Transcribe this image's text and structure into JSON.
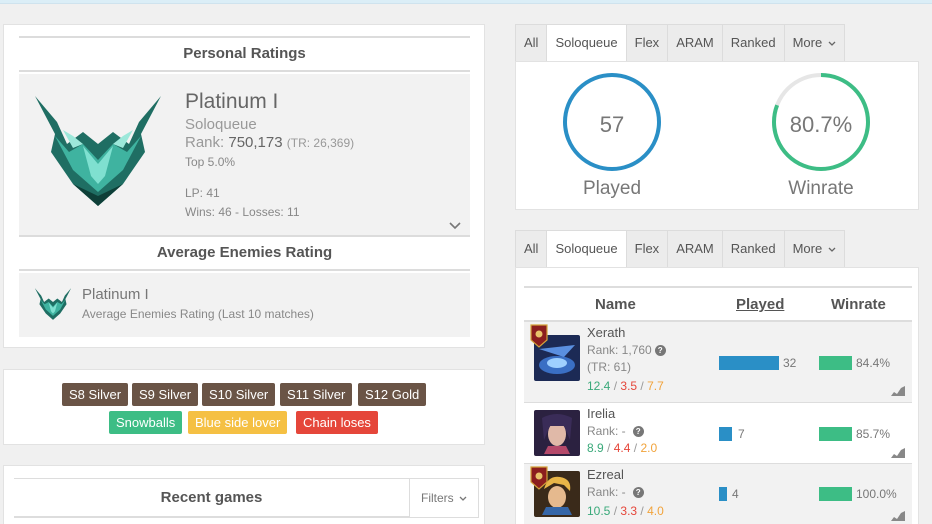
{
  "ratings": {
    "title": "Personal Ratings",
    "tier": "Platinum I",
    "queue": "Soloqueue",
    "rank_label": "Rank:",
    "rank_value": "750,173",
    "tr": "(TR: 26,369)",
    "top": "Top 5.0%",
    "lp": "LP: 41",
    "wins_losses": "Wins: 46 - Losses: 11"
  },
  "enemies": {
    "title": "Average Enemies Rating",
    "tier": "Platinum I",
    "desc": "Average Enemies Rating (Last 10 matches)"
  },
  "badges": {
    "seasons": [
      "S8 Silver",
      "S9 Silver",
      "S10 Silver",
      "S11 Silver",
      "S12 Gold"
    ],
    "tags": [
      "Snowballs",
      "Blue side lover",
      "Chain loses"
    ]
  },
  "recent": {
    "title": "Recent games",
    "filters": "Filters"
  },
  "tabs": [
    "All",
    "Soloqueue",
    "Flex",
    "ARAM",
    "Ranked",
    "More"
  ],
  "stats": {
    "played_value": "57",
    "played_label": "Played",
    "winrate_value": "80.7%",
    "winrate_label": "Winrate",
    "winrate_fraction": 0.807,
    "colors": {
      "played": "#2a8fc6",
      "winrate": "#3dbd85",
      "track": "#e6e6e6"
    }
  },
  "champions": {
    "headers": {
      "name": "Name",
      "played": "Played",
      "winrate": "Winrate"
    },
    "rows": [
      {
        "name": "Xerath",
        "rank": "Rank: 1,760",
        "rank_extra": "(TR: 61)",
        "k": "12.4",
        "d": "3.5",
        "a": "7.7",
        "played": "32",
        "played_fraction": 1.0,
        "winrate": "84.4%",
        "winrate_fraction": 0.844,
        "medal": true
      },
      {
        "name": "Irelia",
        "rank": "Rank: -",
        "rank_extra": "",
        "k": "8.9",
        "d": "4.4",
        "a": "2.0",
        "played": "7",
        "played_fraction": 0.22,
        "winrate": "85.7%",
        "winrate_fraction": 0.857,
        "medal": false
      },
      {
        "name": "Ezreal",
        "rank": "Rank: -",
        "rank_extra": "",
        "k": "10.5",
        "d": "3.3",
        "a": "4.0",
        "played": "4",
        "played_fraction": 0.13,
        "winrate": "100.0%",
        "winrate_fraction": 1.0,
        "medal": true
      }
    ]
  }
}
